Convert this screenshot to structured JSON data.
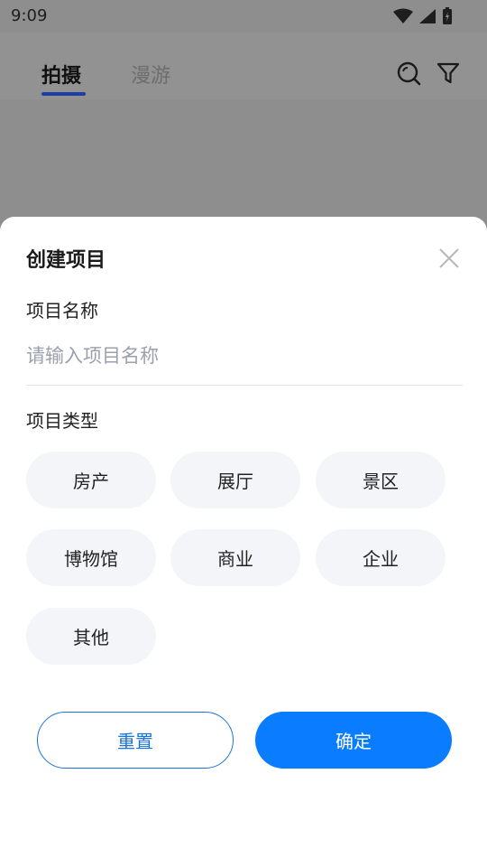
{
  "status_bar": {
    "time": "9:09"
  },
  "header": {
    "tabs": [
      {
        "label": "拍摄",
        "active": true
      },
      {
        "label": "漫游",
        "active": false
      }
    ],
    "search_icon": "search-icon",
    "filter_icon": "filter-icon"
  },
  "sheet": {
    "title": "创建项目",
    "name_label": "项目名称",
    "name_placeholder": "请输入项目名称",
    "name_value": "",
    "type_label": "项目类型",
    "types": [
      "房产",
      "展厅",
      "景区",
      "博物馆",
      "商业",
      "企业",
      "其他"
    ],
    "reset_label": "重置",
    "confirm_label": "确定"
  },
  "colors": {
    "accent": "#0a7cff",
    "chip_bg": "#f4f5f8",
    "tab_indicator": "#1f3fa0"
  }
}
